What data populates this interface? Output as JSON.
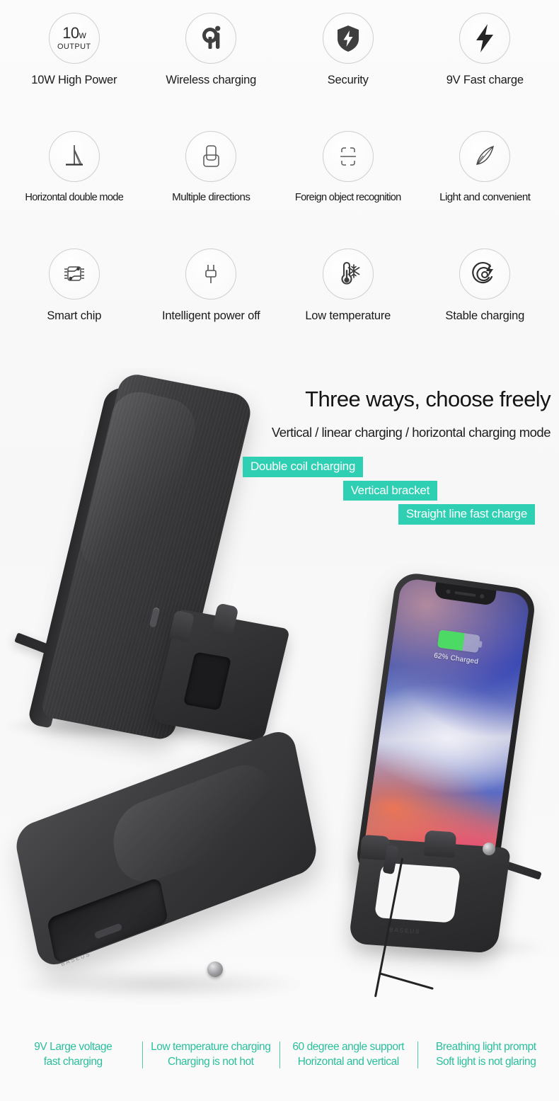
{
  "features": {
    "rows": [
      [
        {
          "icon": "10w-output-icon",
          "label": "10W High Power",
          "badge_big": "10",
          "badge_unit": "w",
          "badge_sub": "OUTPUT"
        },
        {
          "icon": "qi-wireless-logo-icon",
          "label": "Wireless charging"
        },
        {
          "icon": "shield-bolt-security-icon",
          "label": "Security"
        },
        {
          "icon": "lightning-bolt-icon",
          "label": "9V Fast charge"
        }
      ],
      [
        {
          "icon": "tilted-stand-icon",
          "label": "Horizontal double mode"
        },
        {
          "icon": "phone-orientations-icon",
          "label": "Multiple directions"
        },
        {
          "icon": "foreign-object-scan-icon",
          "label": "Foreign object recognition"
        },
        {
          "icon": "feather-light-icon",
          "label": "Light and convenient"
        }
      ],
      [
        {
          "icon": "microchip-icon",
          "label": "Smart chip"
        },
        {
          "icon": "power-plug-icon",
          "label": "Intelligent power off"
        },
        {
          "icon": "thermometer-snowflake-icon",
          "label": "Low temperature"
        },
        {
          "icon": "charging-target-bolt-icon",
          "label": "Stable charging"
        }
      ]
    ]
  },
  "hero": {
    "heading": "Three ways, choose freely",
    "subheading": "Vertical / linear charging / horizontal charging mode",
    "badges": [
      "Double coil charging",
      "Vertical bracket",
      "Straight line fast charge"
    ]
  },
  "phone": {
    "battery_text": "62% Charged",
    "battery_percent": 62
  },
  "brand_emboss": "BASEUS",
  "footer": {
    "columns": [
      {
        "line1": "9V Large voltage",
        "line2": "fast charging"
      },
      {
        "line1": "Low temperature charging",
        "line2": "Charging is not hot"
      },
      {
        "line1": "60 degree angle support",
        "line2": "Horizontal and vertical"
      },
      {
        "line1": "Breathing light prompt",
        "line2": "Soft light is not glaring"
      }
    ]
  },
  "colors": {
    "teal_badge": "#2ECFB2",
    "footer_text": "#2ABF9C",
    "divider": "#52C9AC",
    "battery_green": "#4CD964",
    "product_dark": "#333335",
    "background": "#FAFAFA"
  }
}
